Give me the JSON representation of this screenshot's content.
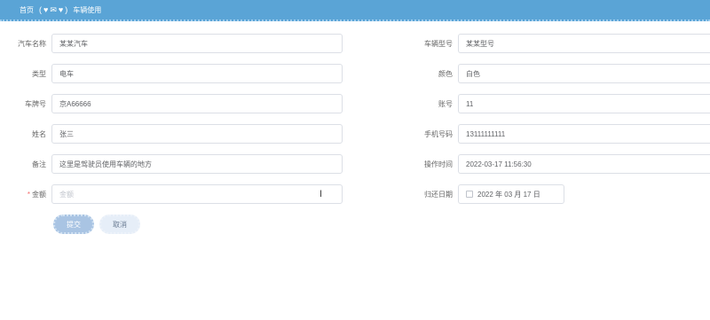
{
  "breadcrumb": {
    "home": "首页",
    "separator_left": "(",
    "separator_right": ")",
    "current": "车辆使用"
  },
  "form": {
    "left": [
      {
        "label": "汽车名称",
        "value": "某某汽车",
        "required": false
      },
      {
        "label": "类型",
        "value": "电车",
        "required": false
      },
      {
        "label": "车牌号",
        "value": "京A66666",
        "required": false
      },
      {
        "label": "姓名",
        "value": "张三",
        "required": false
      },
      {
        "label": "备注",
        "value": "这里是驾驶员使用车辆的地方",
        "required": false
      },
      {
        "label": "金额",
        "value": "",
        "placeholder": "金额",
        "required": true
      }
    ],
    "right": [
      {
        "label": "车辆型号",
        "value": "某某型号"
      },
      {
        "label": "颜色",
        "value": "白色"
      },
      {
        "label": "账号",
        "value": "11"
      },
      {
        "label": "手机号码",
        "value": "13111111111"
      },
      {
        "label": "操作时间",
        "value": "2022-03-17 11:56:30"
      },
      {
        "label": "归还日期",
        "value": "2022 年 03 月 17 日"
      }
    ],
    "required_mark": "*"
  },
  "buttons": {
    "submit": "提交",
    "cancel": "取消"
  },
  "colors": {
    "header": "#5aa4d6",
    "submit": "#a9c4e3",
    "cancel": "#e6eef8",
    "required": "#f56c6c"
  }
}
